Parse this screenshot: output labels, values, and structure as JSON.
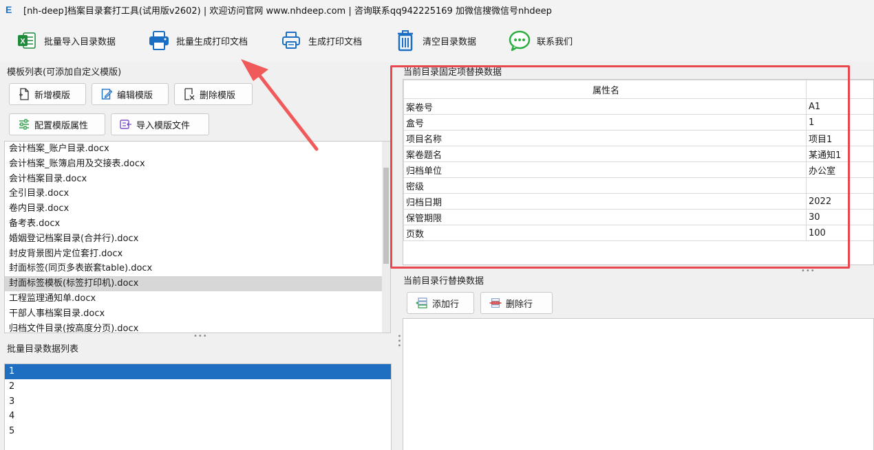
{
  "window": {
    "logo": "E",
    "title": "[nh-deep]档案目录套打工具(试用版v2602) | 欢迎访问官网 www.nhdeep.com | 咨询联系qq942225169 加微信搜微信号nhdeep"
  },
  "toolbar": {
    "import_label": "批量导入目录数据",
    "batch_print_label": "批量生成打印文档",
    "print_label": "生成打印文档",
    "clear_label": "清空目录数据",
    "contact_label": "联系我们"
  },
  "templates": {
    "group_label": "模板列表(可添加自定义模版)",
    "add_label": "新增模版",
    "edit_label": "编辑模版",
    "delete_label": "删除模版",
    "config_label": "配置模版属性",
    "import_label": "导入模版文件",
    "items": [
      "会计档案_账户目录.docx",
      "会计档案_账簿启用及交接表.docx",
      "会计档案目录.docx",
      "全引目录.docx",
      "卷内目录.docx",
      "备考表.docx",
      "婚姻登记档案目录(合并行).docx",
      "封皮背景图片定位套打.docx",
      "封面标签(同页多表嵌套table).docx",
      "封面标签模板(标签打印机).docx",
      "工程监理通知单.docx",
      "干部人事档案目录.docx",
      "归档文件目录(按高度分页).docx"
    ],
    "selected_index": 9
  },
  "batch": {
    "group_label": "批量目录数据列表",
    "items": [
      "1",
      "2",
      "3",
      "4",
      "5"
    ],
    "selected_index": 0
  },
  "fixed": {
    "group_label": "当前目录固定项替换数据",
    "header": "属性名",
    "rows": [
      {
        "name": "案卷号",
        "value": "A1"
      },
      {
        "name": "盒号",
        "value": "1"
      },
      {
        "name": "项目名称",
        "value": "项目1"
      },
      {
        "name": "案卷题名",
        "value": "某通知1"
      },
      {
        "name": "归档单位",
        "value": "办公室"
      },
      {
        "name": "密级",
        "value": ""
      },
      {
        "name": "归档日期",
        "value": "2022"
      },
      {
        "name": "保管期限",
        "value": "30"
      },
      {
        "name": "页数",
        "value": "100"
      }
    ]
  },
  "rowdata": {
    "group_label": "当前目录行替换数据",
    "add_row_label": "添加行",
    "delete_row_label": "删除行"
  },
  "colors": {
    "highlight_box": "#e8474f",
    "arrow": "#f05a5a",
    "selection_blue": "#1e6fc2",
    "selection_gray": "#d7d7d7"
  }
}
